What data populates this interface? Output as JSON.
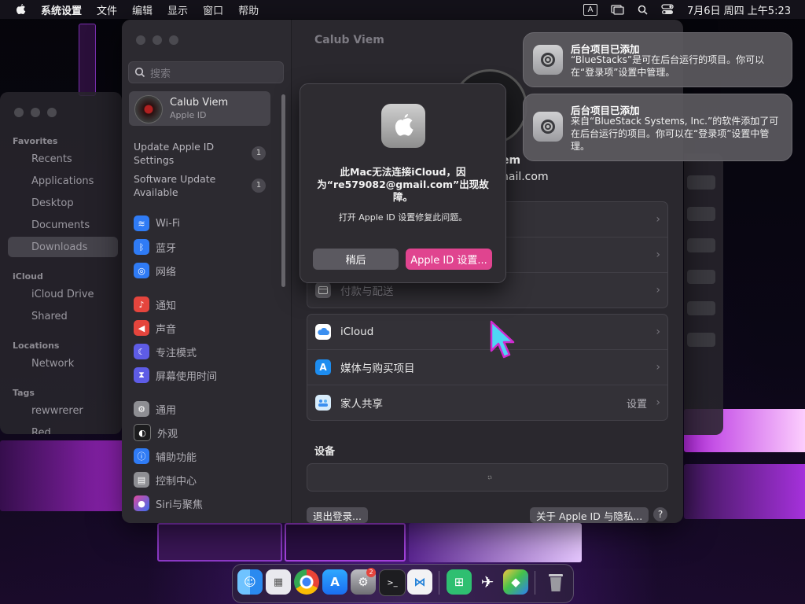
{
  "menubar": {
    "apple_icon": "apple-logo-icon",
    "app_name": "系统设置",
    "items": [
      "文件",
      "编辑",
      "显示",
      "窗口",
      "帮助"
    ],
    "input_indicator": "A",
    "clock": "7月6日 周四 上午5:23"
  },
  "finder": {
    "favorites_title": "Favorites",
    "favorites": [
      "Recents",
      "Applications",
      "Desktop",
      "Documents",
      "Downloads"
    ],
    "icloud_title": "iCloud",
    "icloud": [
      "iCloud Drive",
      "Shared"
    ],
    "locations_title": "Locations",
    "locations": [
      "Network"
    ],
    "tags_title": "Tags",
    "tags": [
      "rewwrerer",
      "Red"
    ]
  },
  "settings": {
    "search_placeholder": "搜索",
    "account": {
      "name": "Calub Viem",
      "subtitle": "Apple ID"
    },
    "updates": [
      {
        "label": "Update Apple ID Settings",
        "badge": "1"
      },
      {
        "label": "Software Update Available",
        "badge": "1"
      }
    ],
    "sidebar_items": [
      {
        "label": "Wi-Fi",
        "icon": "wifi-icon",
        "color": "#2f7bf5"
      },
      {
        "label": "蓝牙",
        "icon": "bluetooth-icon",
        "color": "#2f7bf5"
      },
      {
        "label": "网络",
        "icon": "globe-icon",
        "color": "#2f7bf5"
      },
      {
        "label": "通知",
        "icon": "bell-icon",
        "color": "#e5453d"
      },
      {
        "label": "声音",
        "icon": "speaker-icon",
        "color": "#e5453d"
      },
      {
        "label": "专注模式",
        "icon": "moon-icon",
        "color": "#5e5ce6"
      },
      {
        "label": "屏幕使用时间",
        "icon": "hourglass-icon",
        "color": "#5e5ce6"
      },
      {
        "label": "通用",
        "icon": "gear-icon",
        "color": "#8e8e93"
      },
      {
        "label": "外观",
        "icon": "appearance-icon",
        "color": "#1c1c1e"
      },
      {
        "label": "辅助功能",
        "icon": "accessibility-icon",
        "color": "#2f7bf5"
      },
      {
        "label": "控制中心",
        "icon": "control-center-icon",
        "color": "#8e8e93"
      },
      {
        "label": "Siri与聚焦",
        "icon": "siri-icon",
        "color": "#7b3fe4"
      }
    ],
    "main": {
      "title": "Calub Viem",
      "name_fragment": "em",
      "email_fragment": "nail.com",
      "payment_label": "付款与配送",
      "services": [
        {
          "label": "iCloud",
          "icon": "icloud-icon"
        },
        {
          "label": "媒体与购买项目",
          "icon": "app-store-icon"
        },
        {
          "label": "家人共享",
          "icon": "family-icon",
          "value": "设置"
        }
      ],
      "devices_title": "设备",
      "signout_label": "退出登录...",
      "privacy_label": "关于 Apple ID 与隐私...",
      "help_label": "?"
    }
  },
  "dialog": {
    "message": "此Mac无法连接iCloud，因为“re579082@gmail.com”出现故障。",
    "info": "打开 Apple ID 设置修复此问题。",
    "later_label": "稍后",
    "primary_label": "Apple ID 设置...",
    "accent": "#e0448f"
  },
  "notifications": [
    {
      "title": "后台项目已添加",
      "body": "“BlueStacks”是可在后台运行的项目。你可以在“登录项”设置中管理。"
    },
    {
      "title": "后台项目已添加",
      "body": "来自“BlueStack Systems, Inc.”的软件添加了可在后台运行的项目。你可以在“登录项”设置中管理。"
    }
  ],
  "dock": {
    "apps": [
      "finder-icon",
      "launchpad-icon",
      "chrome-icon",
      "app-store-icon",
      "system-settings-icon",
      "terminal-icon",
      "vscode-icon",
      "excel-like-icon",
      "bluestacks-x-icon",
      "bluestacks-icon",
      "trash-icon"
    ],
    "settings_badge": "2"
  }
}
